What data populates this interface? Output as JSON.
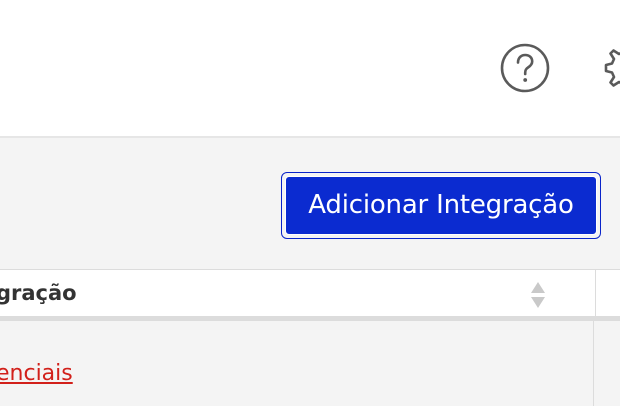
{
  "header": {
    "help_icon": "help-circle-icon",
    "settings_icon": "gear-icon"
  },
  "toolbar": {
    "add_integration_label": "Adicionar Integração",
    "accent_color": "#0b2bd0"
  },
  "table": {
    "columns": [
      {
        "label": "gração",
        "sortable": true
      }
    ],
    "rows": [
      {
        "link_text": "enciais",
        "link_color": "#d2201a"
      }
    ]
  }
}
